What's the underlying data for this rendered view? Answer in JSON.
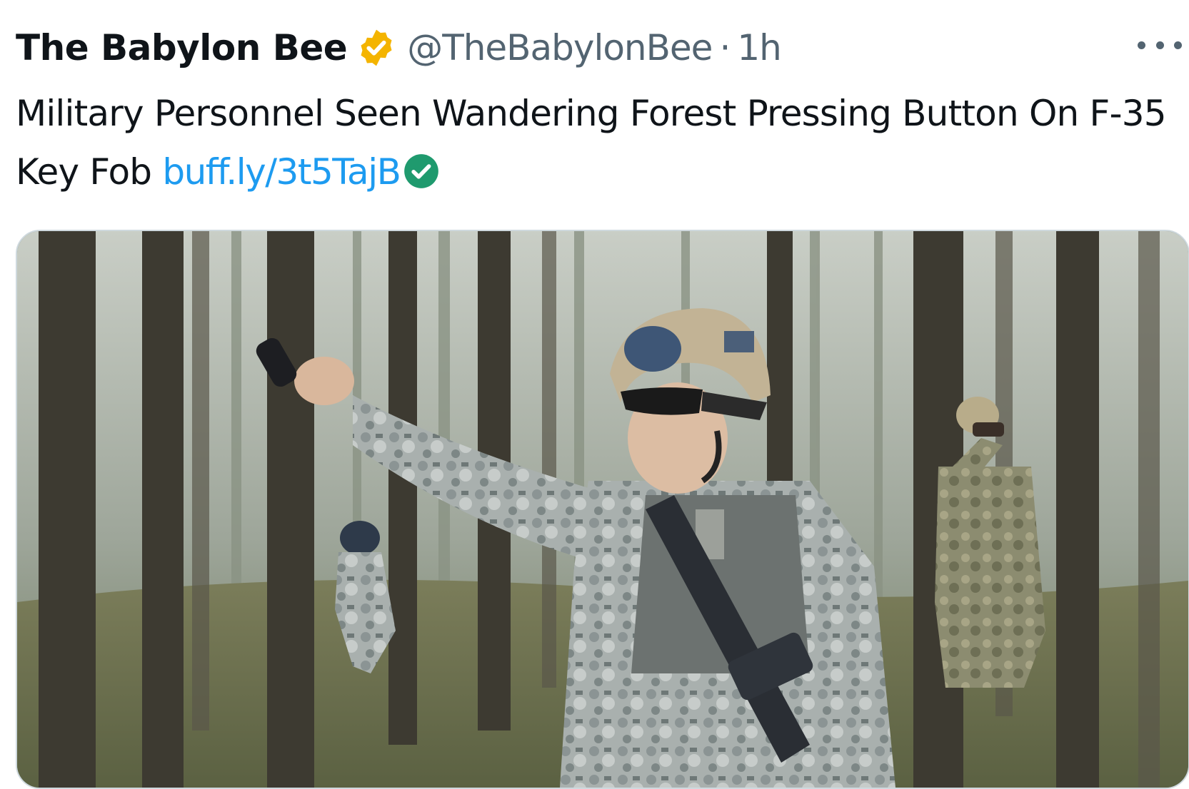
{
  "tweet": {
    "author": {
      "display_name": "The Babylon Bee",
      "verified_badge_icon": "gold-verified-badge-icon",
      "verified_color": "#f4b400",
      "handle": "@TheBabylonBee",
      "separator": "·",
      "time": "1h"
    },
    "more_icon": "more-options-icon",
    "text": "Military Personnel Seen Wandering Forest Pressing Button On F-35 Key Fob ",
    "link": "buff.ly/3t5TajB",
    "link_color": "#1d9bf0",
    "link_check_icon": "green-check-icon",
    "link_check_color": "#1f9a6e",
    "media": {
      "image_icon": "photo-forest-soldiers-icon"
    }
  }
}
